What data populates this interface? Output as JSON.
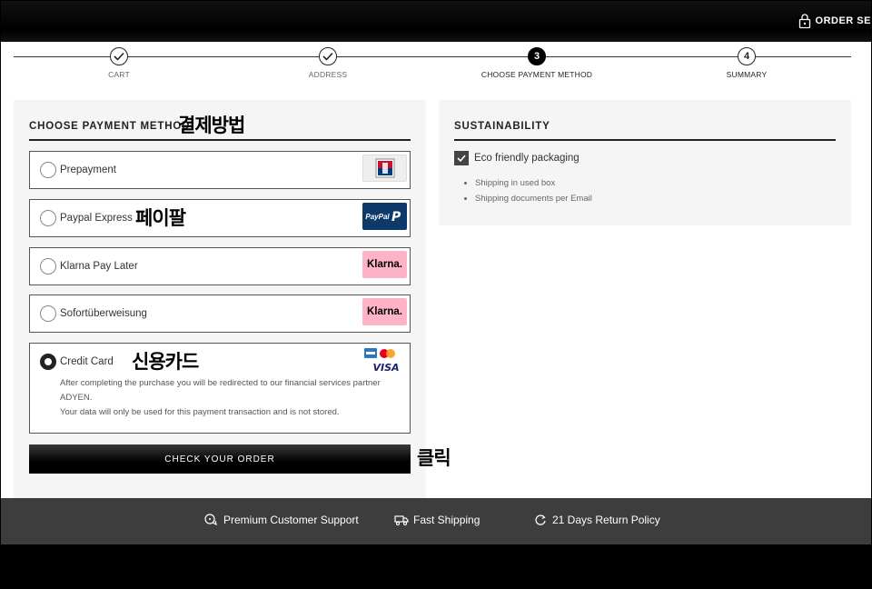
{
  "header": {
    "order_secure_label": "ORDER SE"
  },
  "stepper": {
    "steps": [
      {
        "label": "CART",
        "state": "done"
      },
      {
        "label": "ADDRESS",
        "state": "done"
      },
      {
        "label": "CHOOSE PAYMENT METHOD",
        "number": "3",
        "state": "active"
      },
      {
        "label": "SUMMARY",
        "number": "4",
        "state": "pending"
      }
    ]
  },
  "payment": {
    "title": "CHOOSE PAYMENT METHOD",
    "title_annotation": "결제방법",
    "options": [
      {
        "label": "Prepayment",
        "badge": "ec-icon",
        "selected": false
      },
      {
        "label": "Paypal Express",
        "badge_text": "PayPal",
        "annotation": "페이팔",
        "selected": false
      },
      {
        "label": "Klarna Pay Later",
        "badge_text": "Klarna.",
        "selected": false
      },
      {
        "label": "Sofortüberweisung",
        "badge_text": "Klarna.",
        "selected": false
      },
      {
        "label": "Credit Card",
        "annotation": "신용카드",
        "selected": true,
        "desc_line1": "After completing the purchase you will be redirected to our financial services partner",
        "desc_line2": "ADYEN.",
        "desc_line3": "Your data will only be used for this payment transaction and is not stored.",
        "visa_text": "VISA"
      }
    ],
    "check_button_label": "CHECK YOUR ORDER",
    "button_annotation": "클릭"
  },
  "sustainability": {
    "title": "SUSTAINABILITY",
    "eco_label": "Eco friendly packaging",
    "eco_checked": true,
    "bullets": [
      "Shipping in used box",
      "Shipping documents per Email"
    ]
  },
  "footer": {
    "items": [
      {
        "label": "Premium Customer Support",
        "icon": "chat-icon"
      },
      {
        "label": "Fast Shipping",
        "icon": "truck-icon"
      },
      {
        "label": "21 Days Return Policy",
        "icon": "return-icon"
      }
    ]
  },
  "colors": {
    "klarna_pink": "#ffb3c7",
    "paypal_blue": "#0d3a6b",
    "footer_bg": "#3d3d3d",
    "panel_bg": "#f5f5f5"
  }
}
